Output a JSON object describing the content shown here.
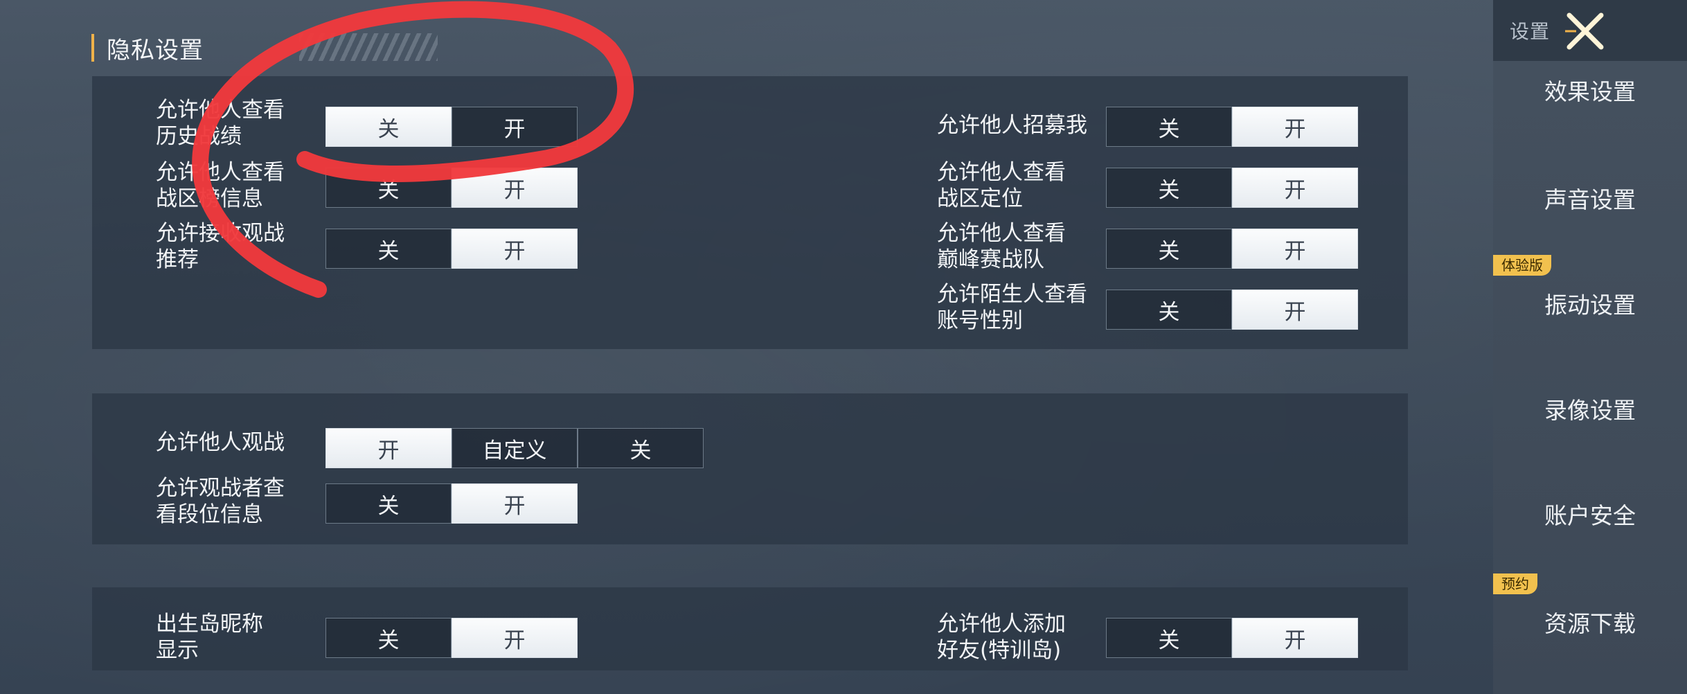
{
  "section": {
    "title": "隐私设置"
  },
  "labels": {
    "off": "关",
    "on": "开",
    "custom": "自定义"
  },
  "panel1": {
    "left": [
      {
        "label": "允许他人查看\n历史战绩",
        "value": "off"
      },
      {
        "label": "允许他人查看\n战区榜信息",
        "value": "on"
      },
      {
        "label": "允许接收观战\n推荐",
        "value": "on"
      }
    ],
    "right": [
      {
        "label": "允许他人招募我",
        "value": "on"
      },
      {
        "label": "允许他人查看\n战区定位",
        "value": "on"
      },
      {
        "label": "允许他人查看\n巅峰赛战队",
        "value": "on"
      },
      {
        "label": "允许陌生人查看\n账号性别",
        "value": "on"
      }
    ]
  },
  "panel2": {
    "spectate": {
      "label": "允许他人观战",
      "value": "on"
    },
    "spectator_rank": {
      "label": "允许观战者查\n看段位信息",
      "value": "on"
    }
  },
  "panel3": {
    "nickname": {
      "label": "出生岛昵称\n显示",
      "value": "on"
    },
    "add_friend": {
      "label": "允许他人添加\n好友(特训岛)",
      "value": "on"
    }
  },
  "sidebar": {
    "title": "设置",
    "items": [
      {
        "label": "效果设置"
      },
      {
        "label": "声音设置"
      },
      {
        "label": "振动设置",
        "badge": "体验版"
      },
      {
        "label": "录像设置"
      },
      {
        "label": "账户安全"
      },
      {
        "label": "资源下载",
        "badge": "预约"
      }
    ]
  },
  "colors": {
    "accent": "#f0b24a",
    "badge": "#f2c14e",
    "annotation": "#f0393c"
  },
  "icons": {
    "close": "close-icon"
  }
}
